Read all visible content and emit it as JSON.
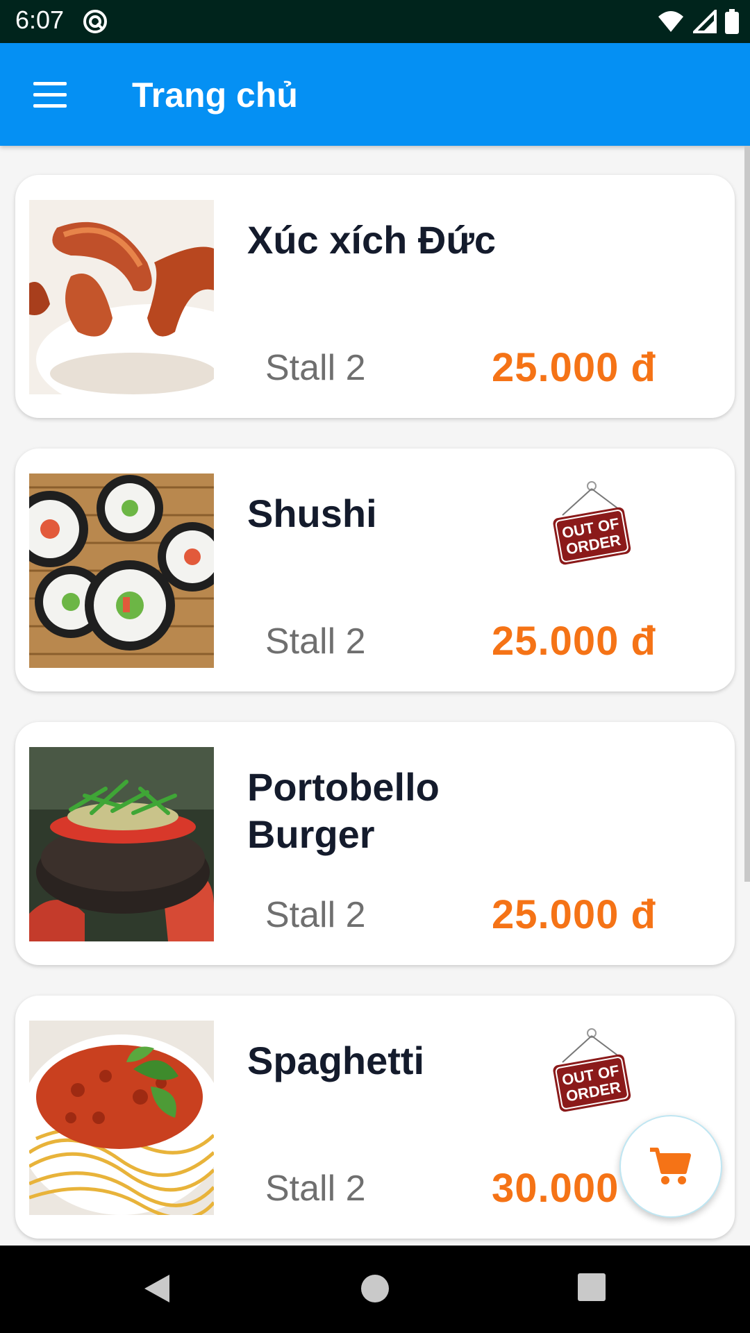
{
  "status_bar": {
    "time": "6:07"
  },
  "app_bar": {
    "title": "Trang chủ"
  },
  "items": [
    {
      "name": "Xúc xích Đức",
      "stall": "Stall 2",
      "price": "25.000 đ",
      "out_of_order": false
    },
    {
      "name": "Shushi",
      "stall": "Stall 2",
      "price": "25.000 đ",
      "out_of_order": true
    },
    {
      "name": "Portobello Burger",
      "stall": "Stall 2",
      "price": "25.000 đ",
      "out_of_order": false
    },
    {
      "name": "Spaghetti",
      "stall": "Stall 2",
      "price": "30.000",
      "out_of_order": true
    }
  ],
  "sign": {
    "line1": "OUT OF",
    "line2": "ORDER"
  },
  "colors": {
    "app_bar": "#0590f3",
    "price": "#f57316",
    "sign": "#8b1a1a"
  },
  "icons": [
    "menu-icon",
    "cart-icon",
    "nav-back-icon",
    "nav-home-icon",
    "nav-recents-icon"
  ]
}
